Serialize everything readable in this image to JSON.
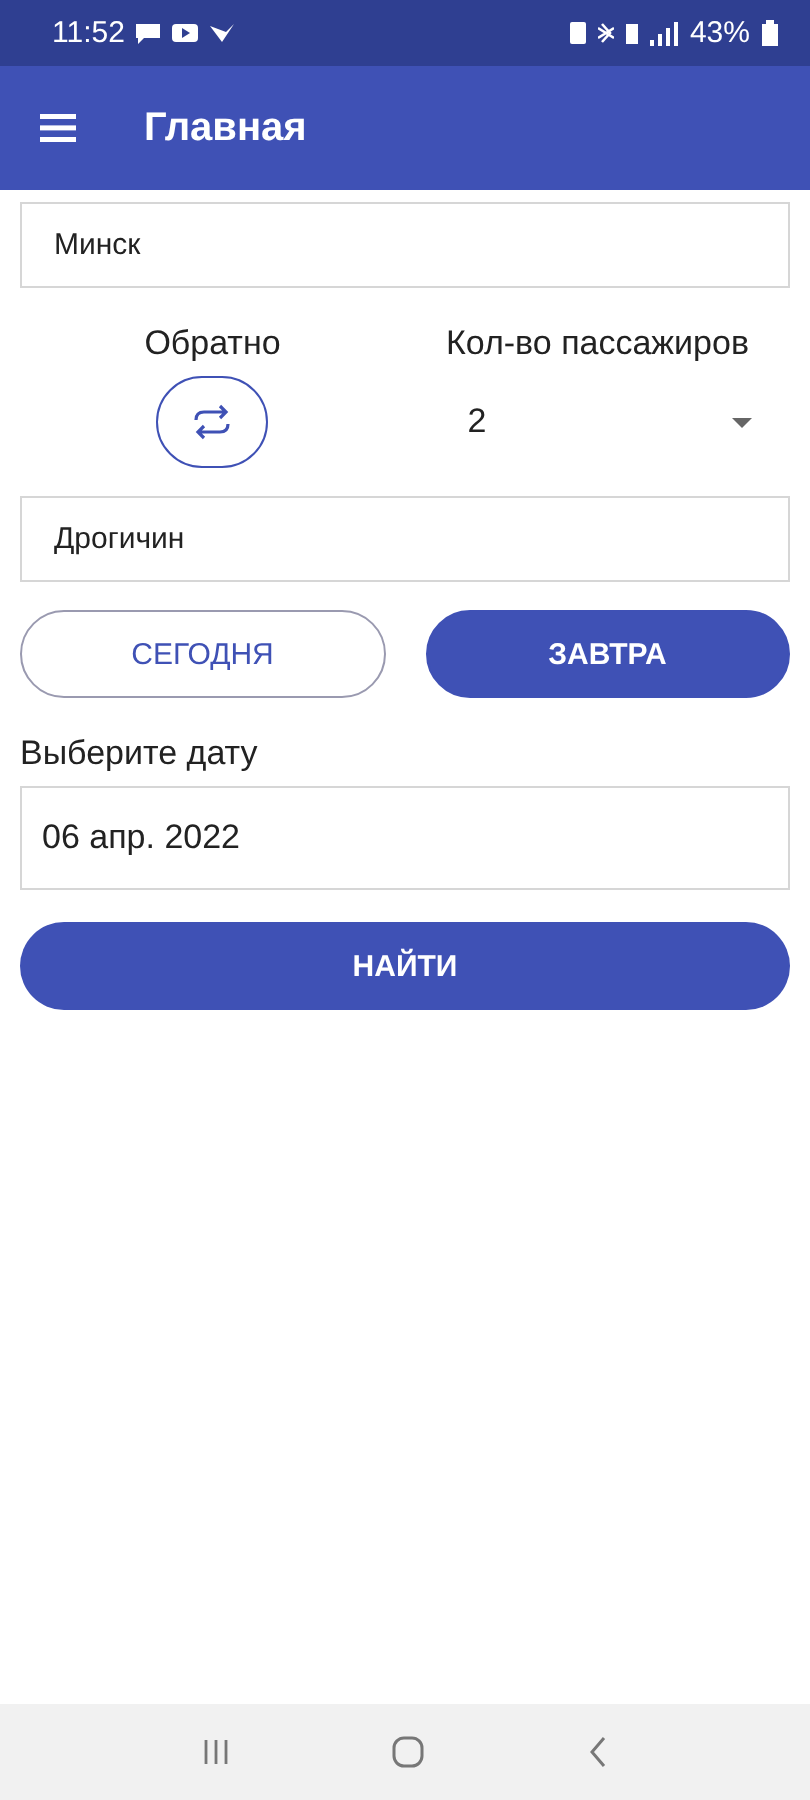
{
  "status_bar": {
    "time": "11:52",
    "battery": "43%"
  },
  "app_bar": {
    "title": "Главная"
  },
  "from_field": {
    "value": "Минск"
  },
  "return": {
    "label": "Обратно"
  },
  "passengers": {
    "label": "Кол-во пассажиров",
    "value": "2"
  },
  "to_field": {
    "value": "Дрогичин"
  },
  "day_buttons": [
    {
      "label": "СЕГОДНЯ",
      "selected": false
    },
    {
      "label": "ЗАВТРА",
      "selected": true
    }
  ],
  "date": {
    "label": "Выберите дату",
    "value": "06 апр. 2022"
  },
  "search_button": {
    "label": "НАЙТИ"
  }
}
